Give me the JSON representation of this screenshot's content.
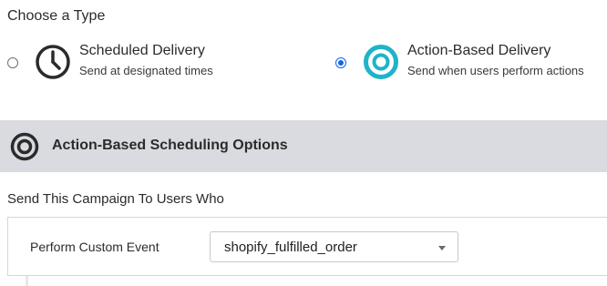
{
  "type_section": {
    "title": "Choose a Type",
    "options": [
      {
        "id": "scheduled",
        "title": "Scheduled Delivery",
        "subtitle": "Send at designated times",
        "icon": "clock-icon",
        "selected": false
      },
      {
        "id": "action",
        "title": "Action-Based Delivery",
        "subtitle": "Send when users perform actions",
        "icon": "target-icon",
        "selected": true
      }
    ]
  },
  "options_bar": {
    "title": "Action-Based Scheduling Options",
    "icon": "target-icon"
  },
  "send_section": {
    "title": "Send This Campaign To Users Who",
    "trigger": {
      "label": "Perform Custom Event",
      "selected_value": "shopify_fulfilled_order"
    }
  },
  "colors": {
    "accent_teal": "#1fb4c7",
    "radio_selected": "#1464e6",
    "bar_background": "#dadbe1",
    "text_dark": "#2b2b2b"
  }
}
